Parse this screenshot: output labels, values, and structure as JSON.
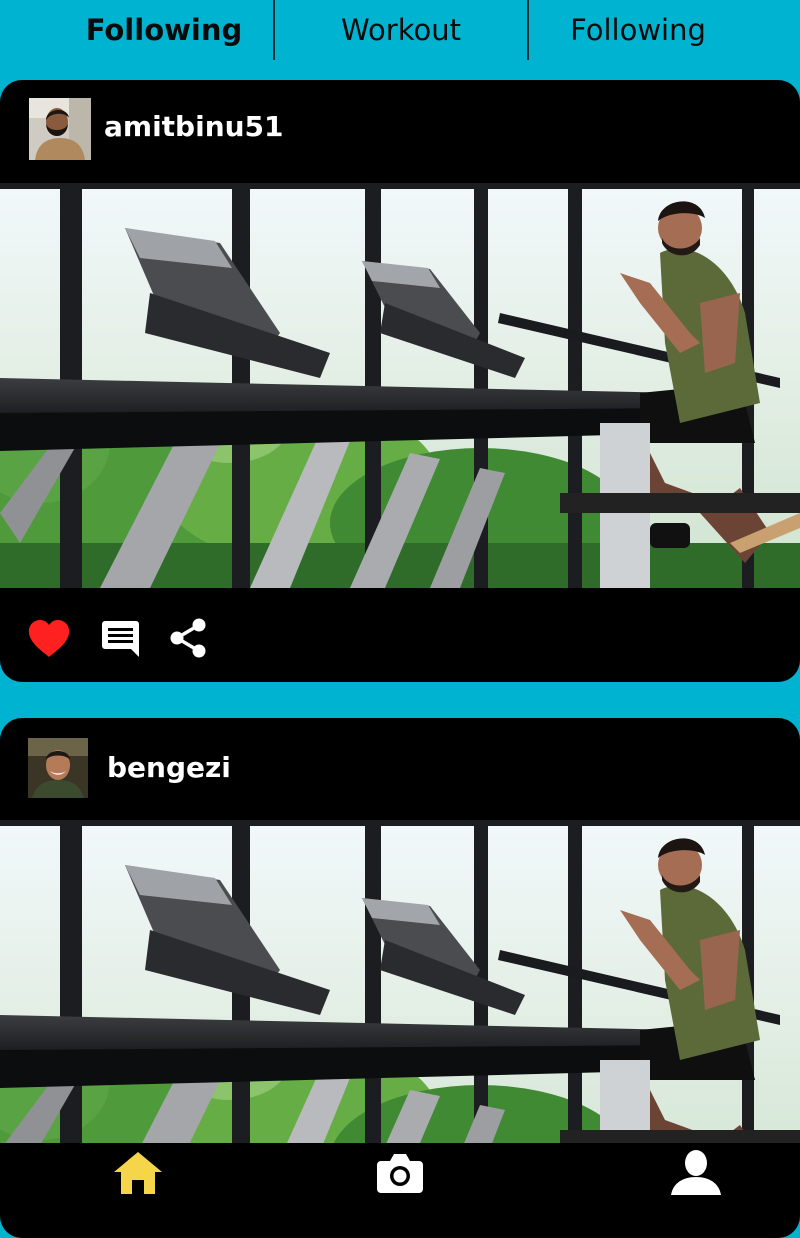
{
  "tabs": [
    {
      "label": "Following",
      "active": true
    },
    {
      "label": "Workout",
      "active": false
    },
    {
      "label": "Following",
      "active": false
    }
  ],
  "posts": [
    {
      "username": "amitbinu51",
      "avatar": "profile-photo-bearded-man",
      "image": "treadmill-runner-gym-photo",
      "liked": true
    },
    {
      "username": "bengezi",
      "avatar": "profile-photo-smiling-man",
      "image": "treadmill-runner-gym-photo"
    }
  ],
  "actions": {
    "like_icon": "heart-icon",
    "comment_icon": "comment-icon",
    "share_icon": "share-icon"
  },
  "bottom_nav": [
    {
      "icon": "home-icon",
      "active": true
    },
    {
      "icon": "camera-icon",
      "active": false
    },
    {
      "icon": "profile-icon",
      "active": false
    }
  ],
  "colors": {
    "background": "#00b3d1",
    "card": "#000000",
    "like_active": "#ff2020",
    "home_active": "#f5d64a",
    "icon": "#ffffff"
  }
}
